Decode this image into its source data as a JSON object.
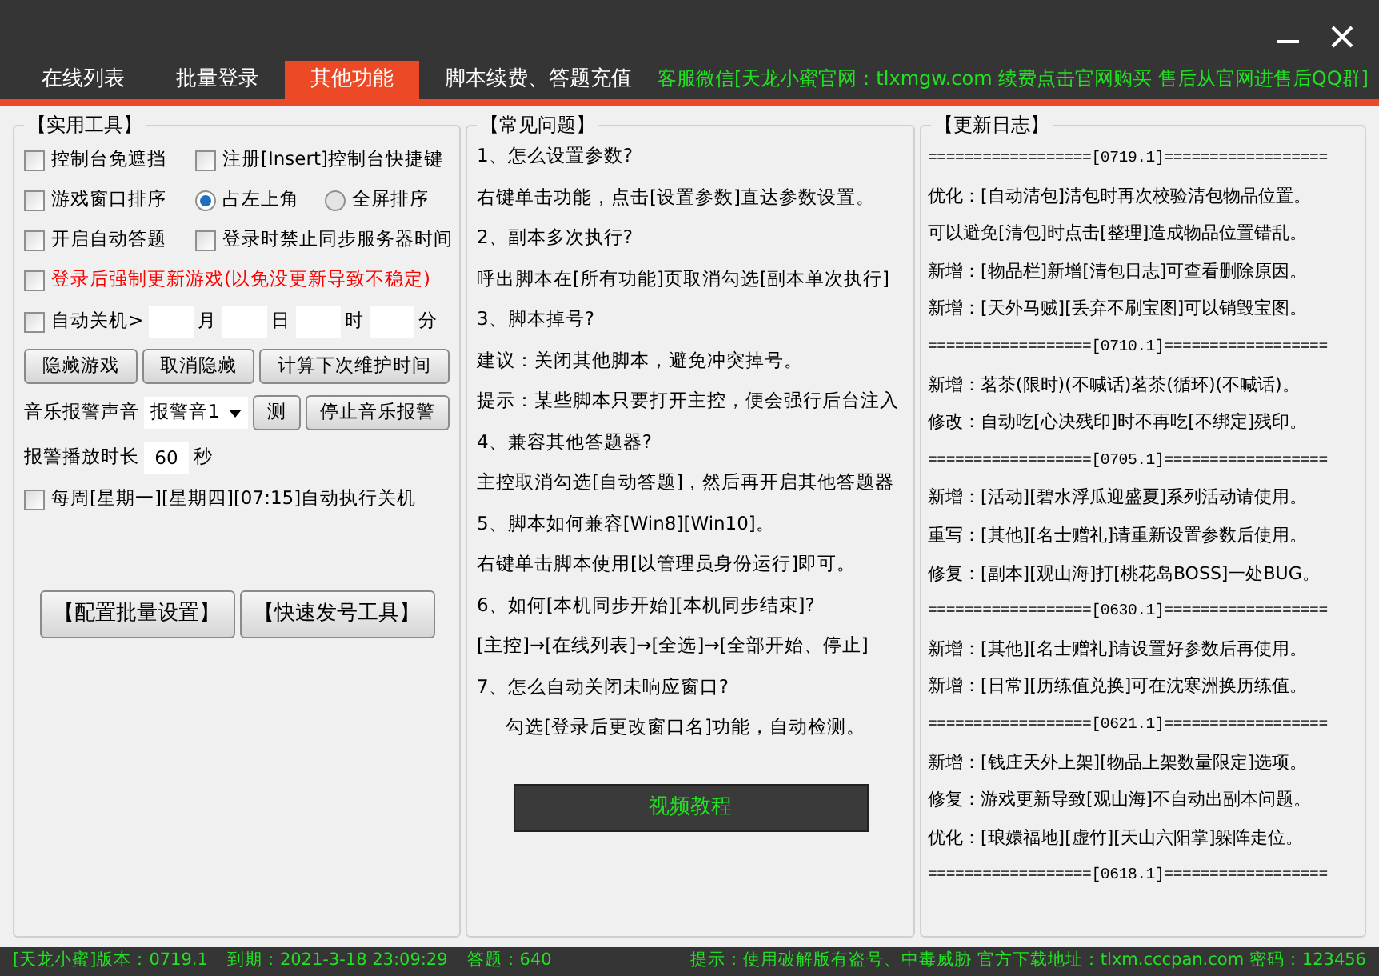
{
  "tabs": [
    {
      "label": "在线列表",
      "selected": false
    },
    {
      "label": "批量登录",
      "selected": false
    },
    {
      "label": "其他功能",
      "selected": true
    },
    {
      "label": "脚本续费、答题充值",
      "selected": false
    }
  ],
  "notice": "客服微信[天龙小蜜官网：tlxmgw.com 续费点击官网购买 售后从官网进售后QQ群]",
  "tools": {
    "title": "【实用工具】",
    "rows": [
      [
        {
          "kind": "checkbox",
          "label": "控制台免遮挡",
          "checked": false
        },
        {
          "kind": "checkbox",
          "label": "注册[Insert]控制台快捷键",
          "checked": false
        }
      ],
      [
        {
          "kind": "checkbox",
          "label": "游戏窗口排序",
          "checked": false
        },
        {
          "kind": "radio",
          "label": "占左上角",
          "selected": true
        },
        {
          "kind": "radio",
          "label": "全屏排序",
          "selected": false
        }
      ],
      [
        {
          "kind": "checkbox",
          "label": "开启自动答题",
          "checked": false
        },
        {
          "kind": "checkbox",
          "label": "登录时禁止同步服务器时间",
          "checked": false
        }
      ],
      [
        {
          "kind": "alert-checkbox",
          "label": "登录后强制更新游戏(以免没更新导致不稳定)",
          "checked": false
        }
      ],
      [
        {
          "kind": "checkbox",
          "label": "自动关机>",
          "checked": false
        },
        {
          "kind": "input"
        },
        {
          "kind": "label",
          "label": "月"
        },
        {
          "kind": "input"
        },
        {
          "kind": "label",
          "label": "日"
        },
        {
          "kind": "input"
        },
        {
          "kind": "label",
          "label": "时"
        },
        {
          "kind": "input"
        },
        {
          "kind": "label",
          "label": "分"
        }
      ],
      [
        {
          "kind": "button",
          "label": "隐藏游戏"
        },
        {
          "kind": "button",
          "label": "取消隐藏"
        },
        {
          "kind": "button",
          "label": "计算下次维护时间"
        }
      ],
      [
        {
          "kind": "label",
          "label": "音乐报警声音"
        },
        {
          "kind": "select",
          "value": "报警音1"
        },
        {
          "kind": "button",
          "label": "测"
        },
        {
          "kind": "button",
          "label": "停止音乐报警"
        }
      ],
      [
        {
          "kind": "label",
          "label": "报警播放时长"
        },
        {
          "kind": "input",
          "value": "60"
        },
        {
          "kind": "label",
          "label": "秒"
        }
      ],
      [
        {
          "kind": "checkbox",
          "label": "每周[星期一][星期四][07:15]自动执行关机",
          "checked": false
        }
      ]
    ],
    "bottom_buttons": [
      "【配置批量设置】",
      "【快速发号工具】"
    ]
  },
  "faq": {
    "title": "【常见问题】",
    "lines": [
      {
        "kind": "question",
        "text": "1、怎么设置参数?"
      },
      {
        "kind": "answer",
        "text": "右键单击功能，点击[设置参数]直达参数设置。"
      },
      {
        "kind": "question",
        "text": "2、副本多次执行?"
      },
      {
        "kind": "answer",
        "text": "呼出脚本在[所有功能]页取消勾选[副本单次执行]"
      },
      {
        "kind": "question",
        "text": "3、脚本掉号?"
      },
      {
        "kind": "answer",
        "text": "建议：关闭其他脚本，避免冲突掉号。"
      },
      {
        "kind": "answer",
        "text": "提示：某些脚本只要打开主控，便会强行后台注入"
      },
      {
        "kind": "question",
        "text": "4、兼容其他答题器?"
      },
      {
        "kind": "answer",
        "text": "主控取消勾选[自动答题]，然后再开启其他答题器"
      },
      {
        "kind": "question",
        "text": "5、脚本如何兼容[Win8][Win10]。"
      },
      {
        "kind": "answer",
        "text": "右键单击脚本使用[以管理员身份运行]即可。"
      },
      {
        "kind": "question",
        "text": "6、如何[本机同步开始][本机同步结束]?"
      },
      {
        "kind": "answer",
        "text": "[主控]→[在线列表]→[全选]→[全部开始、停止]"
      },
      {
        "kind": "question",
        "text": "7、怎么自动关闭未响应窗口?"
      },
      {
        "kind": "note",
        "text": "勾选[登录后更改窗口名]功能，自动检测。"
      }
    ],
    "video_button": "视频教程"
  },
  "changelog": {
    "title": "【更新日志】",
    "lines": [
      {
        "kind": "separator",
        "text": "==================[0719.1]=================="
      },
      {
        "kind": "entry",
        "text": "优化：[自动清包]清包时再次校验清包物品位置。"
      },
      {
        "kind": "entry",
        "text": "可以避免[清包]时点击[整理]造成物品位置错乱。"
      },
      {
        "kind": "entry",
        "text": "新增：[物品栏]新增[清包日志]可查看删除原因。"
      },
      {
        "kind": "entry",
        "text": "新增：[天外马贼][丢弃不刷宝图]可以销毁宝图。"
      },
      {
        "kind": "separator",
        "text": "==================[0710.1]=================="
      },
      {
        "kind": "entry",
        "text": "新增：茗茶(限时)(不喊话)茗茶(循环)(不喊话)。"
      },
      {
        "kind": "entry",
        "text": "修改：自动吃[心决残印]时不再吃[不绑定]残印。"
      },
      {
        "kind": "separator",
        "text": "==================[0705.1]=================="
      },
      {
        "kind": "entry",
        "text": "新增：[活动][碧水浮瓜迎盛夏]系列活动请使用。"
      },
      {
        "kind": "entry",
        "text": "重写：[其他][名士赠礼]请重新设置参数后使用。"
      },
      {
        "kind": "entry",
        "text": "修复：[副本][观山海]打[桃花岛BOSS]一处BUG。"
      },
      {
        "kind": "separator",
        "text": "==================[0630.1]=================="
      },
      {
        "kind": "entry",
        "text": "新增：[其他][名士赠礼]请设置好参数后再使用。"
      },
      {
        "kind": "entry",
        "text": "新增：[日常][历练值兑换]可在沈寒洲换历练值。"
      },
      {
        "kind": "separator",
        "text": "==================[0621.1]=================="
      },
      {
        "kind": "entry",
        "text": "新增：[钱庄天外上架][物品上架数量限定]选项。"
      },
      {
        "kind": "entry",
        "text": "修复：游戏更新导致[观山海]不自动出副本问题。"
      },
      {
        "kind": "entry",
        "text": "优化：[琅嬛福地][虚竹][天山六阳掌]躲阵走位。"
      },
      {
        "kind": "separator",
        "text": "==================[0618.1]=================="
      }
    ]
  },
  "status_bar": {
    "left": [
      "[天龙小蜜]版本：0719.1",
      "到期：2021-3-18 23:09:29",
      "答题：640"
    ],
    "right": "提示：使用破解版有盗号、中毒威胁 官方下载地址：tlxm.cccpan.com 密码：123456"
  }
}
